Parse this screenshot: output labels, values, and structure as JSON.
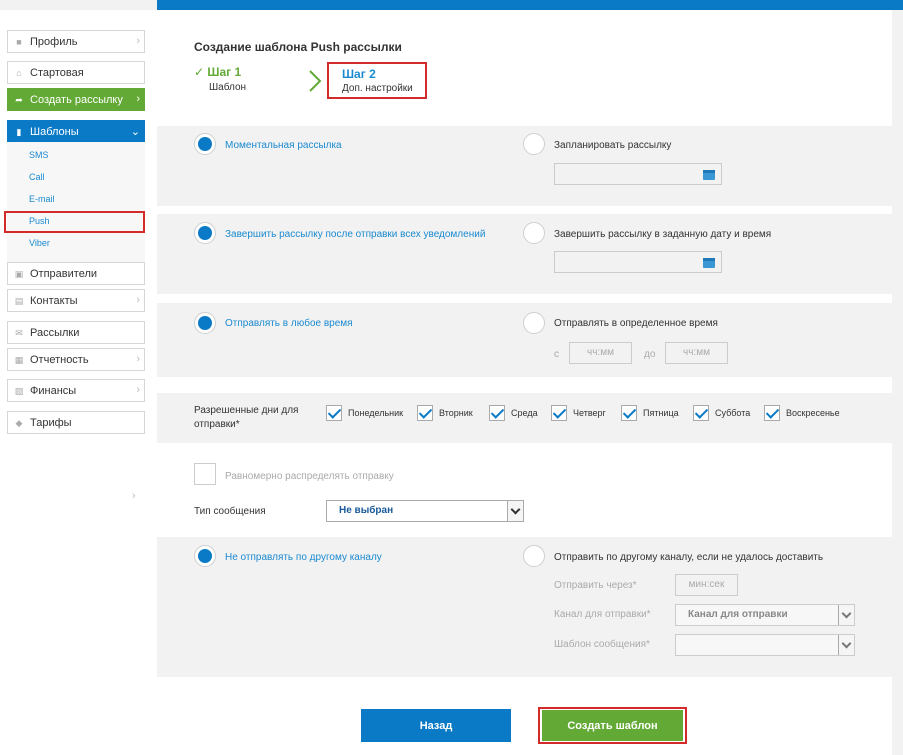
{
  "sidebar": {
    "items": [
      {
        "label": "Профиль",
        "icon": "user-icon"
      },
      {
        "label": "Стартовая",
        "icon": "home-icon"
      },
      {
        "label": "Создать рассылку",
        "icon": "share-arrow-icon"
      },
      {
        "label": "Шаблоны",
        "icon": "document-icon"
      },
      {
        "label": "Отправители",
        "icon": "chat-icon"
      },
      {
        "label": "Контакты",
        "icon": "contacts-icon"
      },
      {
        "label": "Рассылки",
        "icon": "mail-icon"
      },
      {
        "label": "Отчетность",
        "icon": "report-icon"
      },
      {
        "label": "Финансы",
        "icon": "finance-icon"
      },
      {
        "label": "Тарифы",
        "icon": "tag-icon"
      }
    ],
    "templates_sub": [
      "SMS",
      "Call",
      "E-mail",
      "Push",
      "Viber"
    ]
  },
  "header": {
    "title": "Создание шаблона Push рассылки",
    "step1": {
      "title": "Шаг 1",
      "subtitle": "Шаблон"
    },
    "step2": {
      "title": "Шаг 2",
      "subtitle": "Доп. настройки"
    }
  },
  "send_time": {
    "instant": "Моментальная рассылка",
    "scheduled": "Запланировать рассылку"
  },
  "finish": {
    "after_all": "Завершить рассылку после отправки всех уведомлений",
    "at_date": "Завершить рассылку в заданную дату и время"
  },
  "send_window": {
    "any_time": "Отправлять в любое время",
    "specific_time": "Отправлять в определенное время",
    "from": "с",
    "to": "до",
    "from_placeholder": "чч:мм",
    "to_placeholder": "чч:мм"
  },
  "days": {
    "label": "Разрешенные дни для отправки*",
    "items": [
      {
        "name": "Понедельник",
        "checked": true
      },
      {
        "name": "Вторник",
        "checked": true
      },
      {
        "name": "Среда",
        "checked": true
      },
      {
        "name": "Четверг",
        "checked": true
      },
      {
        "name": "Пятница",
        "checked": true
      },
      {
        "name": "Суббота",
        "checked": true
      },
      {
        "name": "Воскресенье",
        "checked": true
      }
    ]
  },
  "even_distribution": {
    "label": "Равномерно распределять отправку",
    "checked": false
  },
  "message_type": {
    "label": "Тип сообщения",
    "value": "Не выбран"
  },
  "fallback": {
    "no_other": "Не отправлять по другому каналу",
    "other": "Отправить по другому каналу, если не удалось доставить",
    "send_after_label": "Отправить через*",
    "send_after_placeholder": "мин:сек",
    "channel_label": "Канал для отправки*",
    "channel_value": "Канал для отправки",
    "template_label": "Шаблон сообщения*",
    "template_value": ""
  },
  "buttons": {
    "back": "Назад",
    "create": "Создать шаблон"
  },
  "colors": {
    "primary": "#0a7ac6",
    "success": "#62a935",
    "highlight": "#d32a2a"
  }
}
